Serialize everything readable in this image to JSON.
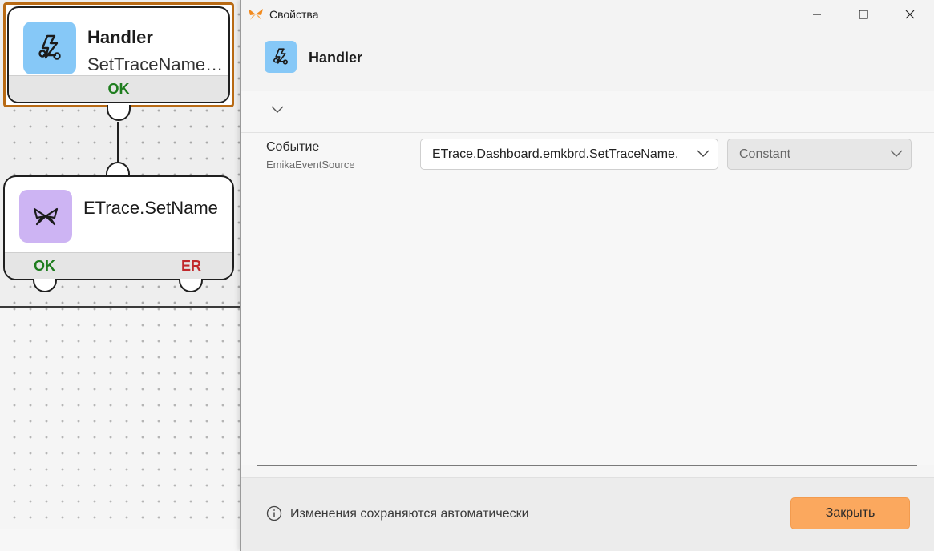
{
  "canvas": {
    "node_handler": {
      "title": "Handler",
      "subtitle": "SetTraceName…",
      "port_ok": "OK"
    },
    "node_setname": {
      "title": "ETrace.SetName",
      "port_ok": "OK",
      "port_er": "ER"
    }
  },
  "dialog": {
    "window_title": "Свойства",
    "header_title": "Handler",
    "property": {
      "label": "Событие",
      "sublabel": "EmikaEventSource",
      "event_value": "ETrace.Dashboard.emkbrd.SetTraceName.",
      "type_value": "Constant"
    },
    "footer_note": "Изменения сохраняются автоматически",
    "close_label": "Закрыть"
  },
  "colors": {
    "accent_orange": "#fba85e",
    "selection_border": "#b86a14",
    "handler_icon_bg": "#86c8f7",
    "etrace_icon_bg": "#cdb4f3",
    "ok_green": "#1e7d1e",
    "error_red": "#c0282b"
  },
  "icons": {
    "app": "butterfly-icon",
    "handler": "lightning-plug-icon",
    "etrace": "butterfly-icon",
    "info": "info-icon"
  }
}
